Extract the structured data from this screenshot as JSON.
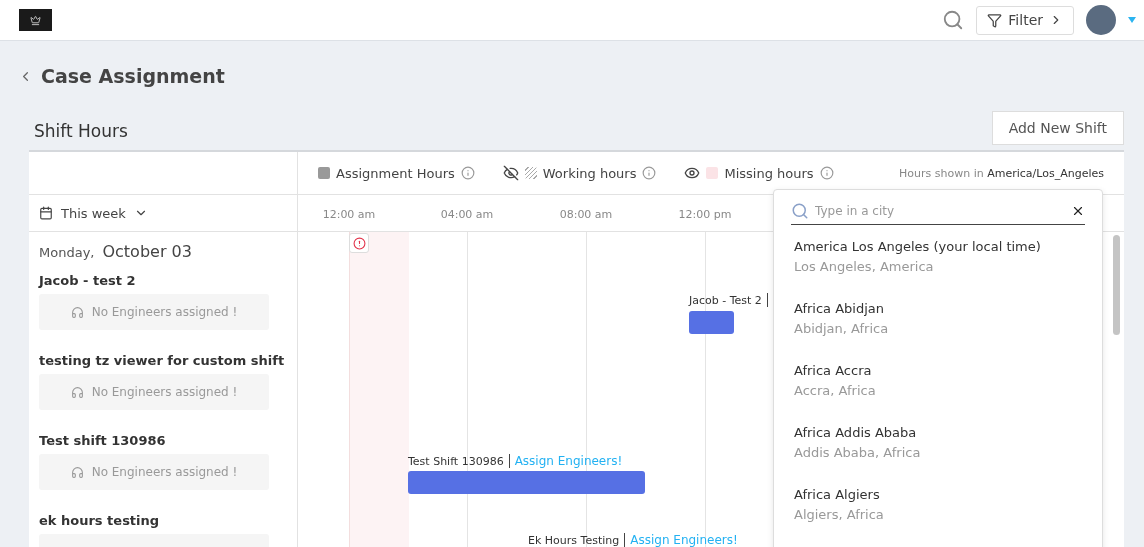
{
  "header": {
    "filter_label": "Filter"
  },
  "page": {
    "title": "Case Assignment",
    "section": "Shift Hours",
    "add_button": "Add New Shift"
  },
  "legend": [
    {
      "kind": "solid",
      "label": "Assignment Hours"
    },
    {
      "kind": "hatched",
      "label": "Working hours",
      "visible": false
    },
    {
      "kind": "pink",
      "label": "Missing hours",
      "visible": true
    }
  ],
  "timezone": {
    "prefix": "Hours shown in",
    "zone": "America/Los_Angeles"
  },
  "range": "This week",
  "ticks": [
    "12:00 am",
    "04:00 am",
    "08:00 am",
    "12:00 pm"
  ],
  "day": {
    "weekday": "Monday,",
    "date": "October 03"
  },
  "shifts": [
    {
      "name": "Jacob - test 2",
      "note": "No Engineers assigned !",
      "bar_label": "Jacob - Test 2"
    },
    {
      "name": "testing tz viewer for custom shift",
      "note": "No Engineers assigned !"
    },
    {
      "name": "Test shift 130986",
      "note": "No Engineers assigned !",
      "bar_label": "Test Shift 130986",
      "action": "Assign Engineers!"
    },
    {
      "name": "ek hours testing",
      "bar_label": "Ek Hours Testing",
      "action": "Assign Engineers!"
    }
  ],
  "timezone_picker": {
    "placeholder": "Type in a city",
    "options": [
      {
        "name": "America Los Angeles (your local time)",
        "detail": "Los Angeles, America"
      },
      {
        "name": "Africa Abidjan",
        "detail": "Abidjan, Africa"
      },
      {
        "name": "Africa Accra",
        "detail": "Accra, Africa"
      },
      {
        "name": "Africa Addis Ababa",
        "detail": "Addis Ababa, Africa"
      },
      {
        "name": "Africa Algiers",
        "detail": "Algiers, Africa"
      }
    ]
  }
}
